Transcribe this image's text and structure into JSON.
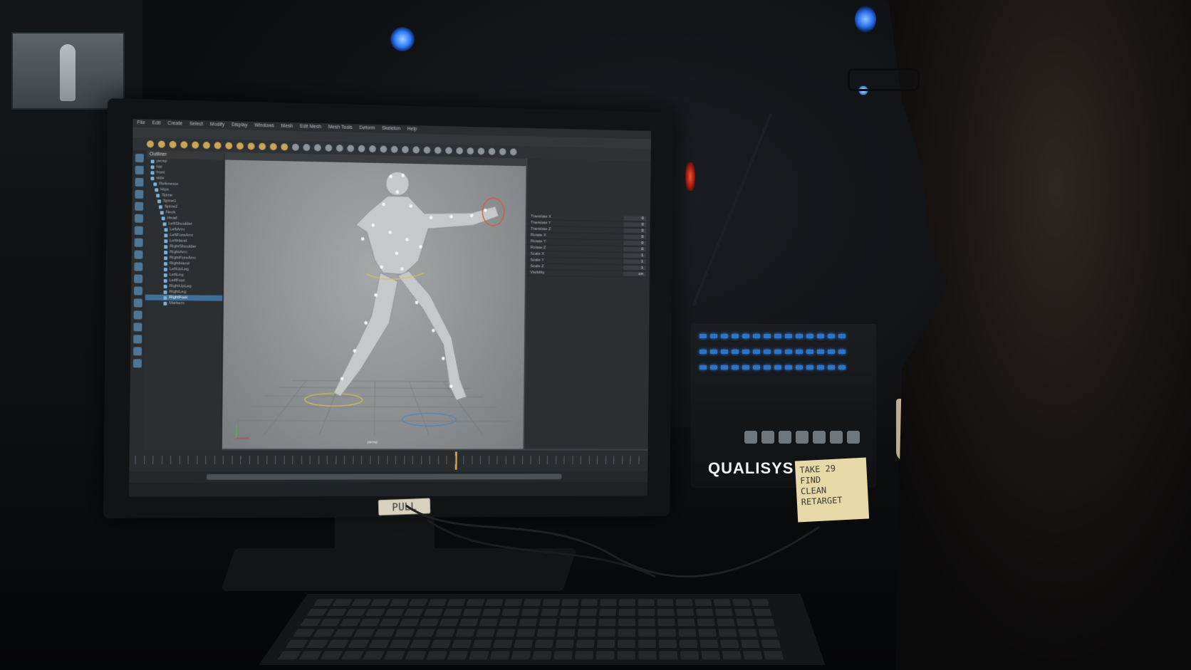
{
  "scene": {
    "description_labels": {
      "bezel_label": "PULL",
      "device_brand": "QUALISYS",
      "sticky_note_lines": [
        "TAKE 29",
        "FIND",
        "CLEAN",
        "RETARGET"
      ]
    }
  },
  "app": {
    "menu": [
      "File",
      "Edit",
      "Create",
      "Select",
      "Modify",
      "Display",
      "Windows",
      "Mesh",
      "Edit Mesh",
      "Mesh Tools",
      "Deform",
      "Skeleton",
      "Help"
    ],
    "outliner_title": "Outliner",
    "outliner_items": [
      "persp",
      "top",
      "front",
      "side",
      "Reference",
      "Hips",
      "Spine",
      "Spine1",
      "Spine2",
      "Neck",
      "Head",
      "LeftShoulder",
      "LeftArm",
      "LeftForeArm",
      "LeftHand",
      "RightShoulder",
      "RightArm",
      "RightForeArm",
      "RightHand",
      "LeftUpLeg",
      "LeftLeg",
      "LeftFoot",
      "RightUpLeg",
      "RightLeg",
      "RightFoot",
      "Markers"
    ],
    "selected_outliner_index": 24,
    "channel_rows": [
      {
        "name": "Translate X",
        "value": "0"
      },
      {
        "name": "Translate Y",
        "value": "0"
      },
      {
        "name": "Translate Z",
        "value": "0"
      },
      {
        "name": "Rotate X",
        "value": "0"
      },
      {
        "name": "Rotate Y",
        "value": "0"
      },
      {
        "name": "Rotate Z",
        "value": "0"
      },
      {
        "name": "Scale X",
        "value": "1"
      },
      {
        "name": "Scale Y",
        "value": "1"
      },
      {
        "name": "Scale Z",
        "value": "1"
      },
      {
        "name": "Visibility",
        "value": "on"
      }
    ],
    "viewport_label": "persp",
    "playhead_fraction": 0.62
  },
  "colors": {
    "accent_blue": "#2a74c9",
    "cam_light": "#2e7bff",
    "sticky_note": "#e7d8a8"
  }
}
